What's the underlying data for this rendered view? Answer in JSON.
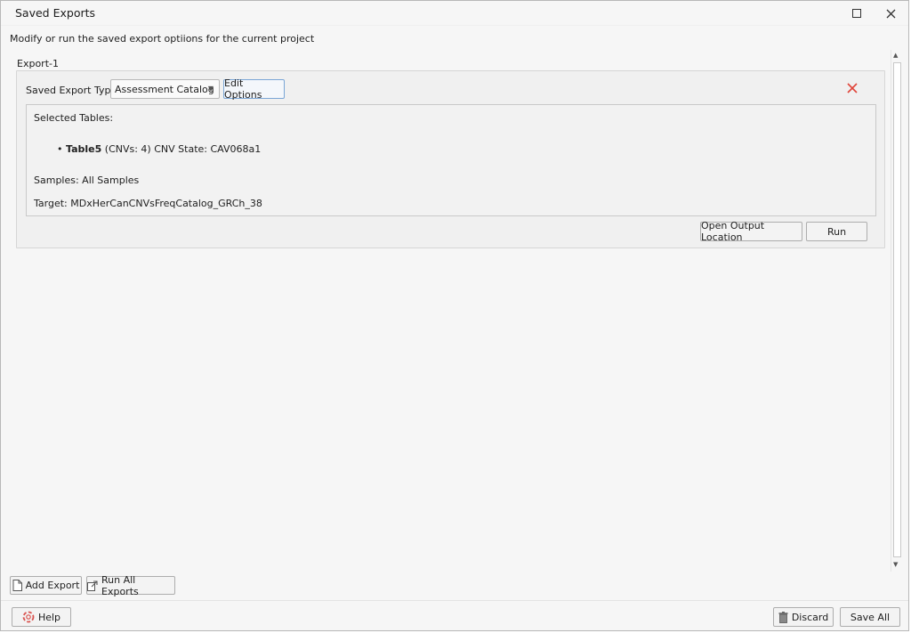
{
  "window": {
    "title": "Saved Exports",
    "maximize_icon": "maximize-icon",
    "close_icon": "close-icon"
  },
  "subtitle": "Modify or run the saved export optiions for the current project",
  "exports": [
    {
      "label": "Export-1",
      "type_label": "Saved Export Type:",
      "type_value": "Assessment Catalog",
      "edit_options_label": "Edit Options",
      "delete_icon": "delete-x-icon",
      "selected_tables_label": "Selected Tables:",
      "table_name": "Table5",
      "table_detail": " (CNVs: 4) CNV State: CAV068a1",
      "samples_text": "Samples: All Samples",
      "target_text": "Target: MDxHerCanCNVsFreqCatalog_GRCh_38",
      "open_output_label": "Open Output Location",
      "run_label": "Run"
    }
  ],
  "footer": {
    "add_export_label": "Add Export",
    "run_all_label": "Run All Exports",
    "help_label": "Help",
    "discard_label": "Discard",
    "save_all_label": "Save All"
  },
  "colors": {
    "delete_red": "#e0453a",
    "help_red": "#d9534f",
    "accent_focus": "#7aa6d6"
  }
}
